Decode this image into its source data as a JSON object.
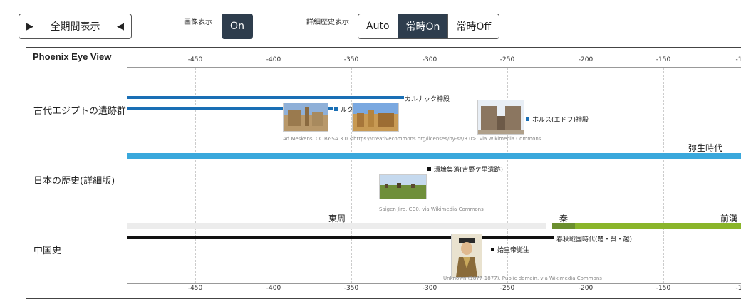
{
  "toolbar": {
    "full_period_label": "全期間表示",
    "image_toggle_label": "画像表示",
    "image_toggle_value": "On",
    "detail_label": "詳細歴史表示",
    "detail_options": [
      "Auto",
      "常時On",
      "常時Off"
    ],
    "detail_selected": "常時On"
  },
  "panel": {
    "title": "Phoenix Eye View",
    "ticks": [
      "-450",
      "-400",
      "-350",
      "-300",
      "-250",
      "-200",
      "-150",
      "-1"
    ],
    "rows": [
      {
        "label": "古代エジプトの遺跡群"
      },
      {
        "label": "日本の歴史(詳細版)"
      },
      {
        "label": "中国史"
      }
    ]
  },
  "egypt": {
    "events": [
      "カルナック神殿",
      "ルクソール神殿",
      "ホルス(エドフ)神殿"
    ],
    "credit": "Ad Meskens, CC BY-SA 3.0 <https://creativecommons.org/licenses/by-sa/3.0>, via Wikimedia Commons"
  },
  "japan": {
    "period": "弥生時代",
    "events": [
      "環壕集落(吉野ケ里遺跡)"
    ],
    "credit": "Saigen Jiro, CC0, via Wikimedia Commons"
  },
  "china": {
    "periods": [
      "東周",
      "秦",
      "前漢"
    ],
    "events": [
      "春秋戦国時代(楚・呉・越)",
      "始皇帝誕生"
    ],
    "credit": "Unknown (1877-1877), Public domain, via Wikimedia Commons"
  },
  "colors": {
    "egypt_bar": "#1a6fb5",
    "japan_bar": "#3aa8dc",
    "china_bar": "#111111",
    "qin_bar": "#6b8f2e",
    "han_bar": "#8ab52a",
    "zhou_bg": "#ececec",
    "button_dark": "#2e3d4d"
  }
}
